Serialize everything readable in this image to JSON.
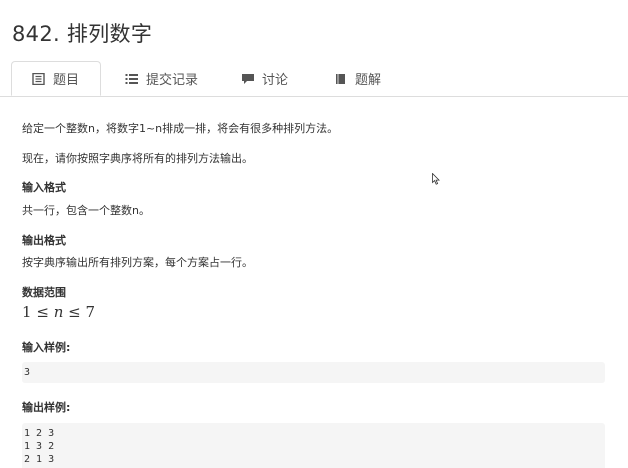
{
  "problem": {
    "title": "842. 排列数字"
  },
  "tabs": [
    {
      "label": "题目",
      "icon": "document-icon",
      "active": true
    },
    {
      "label": "提交记录",
      "icon": "list-icon",
      "active": false
    },
    {
      "label": "讨论",
      "icon": "comment-icon",
      "active": false
    },
    {
      "label": "题解",
      "icon": "book-icon",
      "active": false
    }
  ],
  "description": {
    "line1": "给定一个整数n，将数字1~n排成一排，将会有很多种排列方法。",
    "line2": "现在，请你按照字典序将所有的排列方法输出。"
  },
  "input_format": {
    "heading": "输入格式",
    "text": "共一行，包含一个整数n。"
  },
  "output_format": {
    "heading": "输出格式",
    "text": "按字典序输出所有排列方案，每个方案占一行。"
  },
  "data_range": {
    "heading": "数据范围",
    "lower": "1",
    "op1": "≤",
    "var": "n",
    "op2": "≤",
    "upper": "7"
  },
  "sample_input": {
    "heading": "输入样例:",
    "lines": [
      "3"
    ]
  },
  "sample_output": {
    "heading": "输出样例:",
    "lines": [
      "1 2 3",
      "1 3 2",
      "2 1 3"
    ]
  },
  "colors": {
    "text": "#333333",
    "border": "#dddddd",
    "code_bg": "#f5f5f5"
  }
}
